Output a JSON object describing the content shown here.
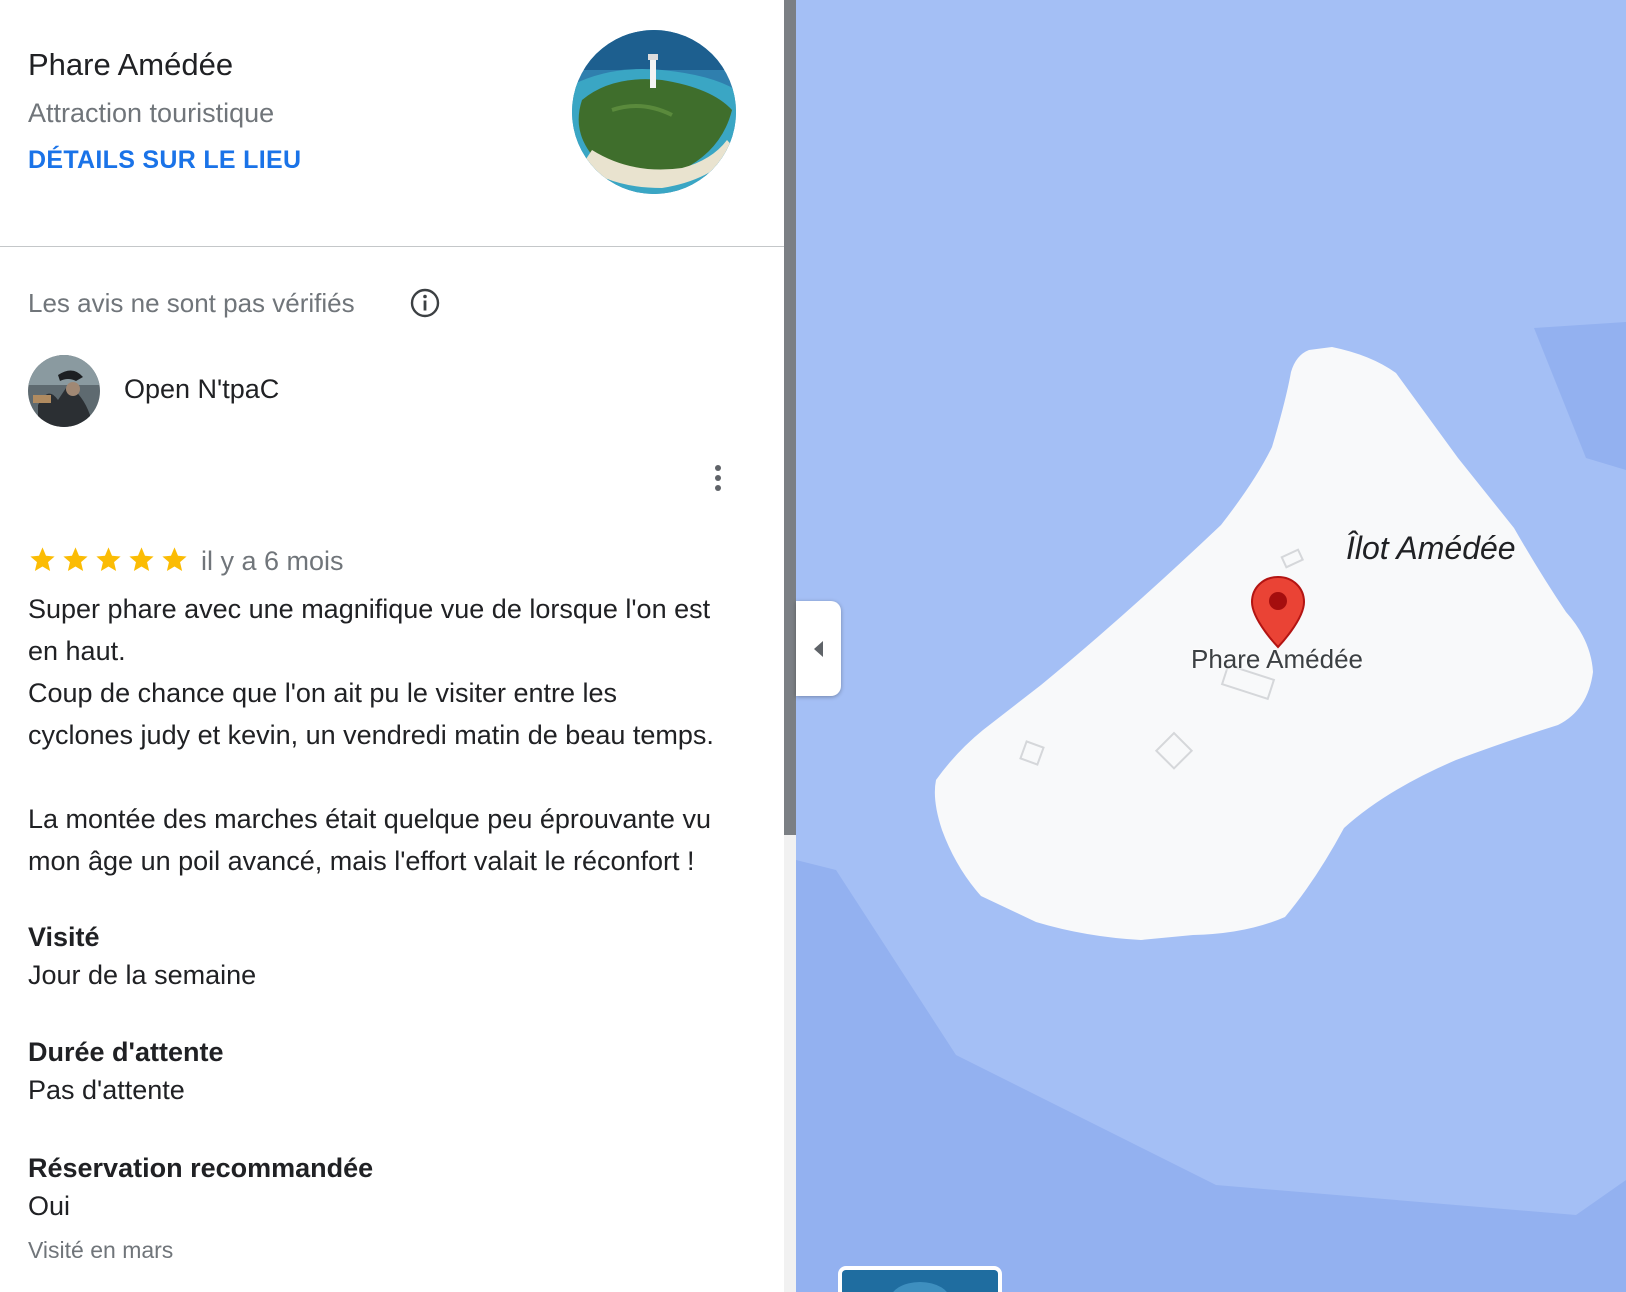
{
  "place": {
    "name": "Phare Amédée",
    "category": "Attraction touristique",
    "details_link": "DÉTAILS SUR LE LIEU"
  },
  "reviews_notice": "Les avis ne sont pas vérifiés",
  "review": {
    "reviewer": "Open N'tpaC",
    "rating": 5,
    "rating_max": 5,
    "date": "il y a 6 mois",
    "text_lines": [
      "Super phare avec une magnifique vue de lorsque l'on est",
      "en haut.",
      "Coup de chance que l'on ait pu le visiter entre les",
      "cyclones judy et kevin, un vendredi matin de beau temps.",
      "La montée des marches était quelque peu éprouvante vu",
      "mon âge un poil avancé, mais l'effort valait le réconfort !"
    ],
    "attributes": [
      {
        "label": "Visité",
        "value": "Jour de la semaine"
      },
      {
        "label": "Durée d'attente",
        "value": "Pas d'attente"
      },
      {
        "label": "Réservation recommandée",
        "value": "Oui"
      }
    ],
    "visited_note": "Visité en mars"
  },
  "map": {
    "islet_label": "Îlot Amédée",
    "poi_label": "Phare Amédée"
  },
  "colors": {
    "accent": "#1a73e8",
    "star": "#fbbc04",
    "pin": "#ea4335",
    "water": "#a4bff5",
    "land": "#f8f9fa"
  }
}
